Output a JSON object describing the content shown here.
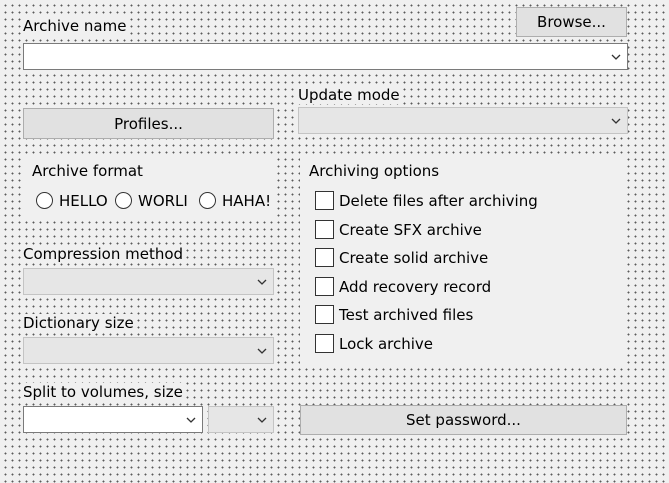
{
  "archive_name": {
    "label": "Archive name",
    "browse_label": "Browse...",
    "value": ""
  },
  "profiles_label": "Profiles...",
  "update_mode": {
    "label": "Update mode",
    "value": ""
  },
  "archive_format": {
    "label": "Archive format",
    "options": [
      "HELLO",
      "WORLI",
      "HAHA!"
    ]
  },
  "compression_method": {
    "label": "Compression method",
    "value": ""
  },
  "dictionary_size": {
    "label": "Dictionary size",
    "value": ""
  },
  "split_volumes": {
    "label": "Split to volumes, size",
    "value": "",
    "unit": ""
  },
  "set_password_label": "Set password...",
  "archiving_options": {
    "label": "Archiving options",
    "items": [
      {
        "label": "Delete files after archiving",
        "checked": false
      },
      {
        "label": "Create SFX archive",
        "checked": false
      },
      {
        "label": "Create solid archive",
        "checked": false
      },
      {
        "label": "Add recovery record",
        "checked": false
      },
      {
        "label": "Test archived files",
        "checked": false
      },
      {
        "label": "Lock archive",
        "checked": false
      }
    ]
  }
}
